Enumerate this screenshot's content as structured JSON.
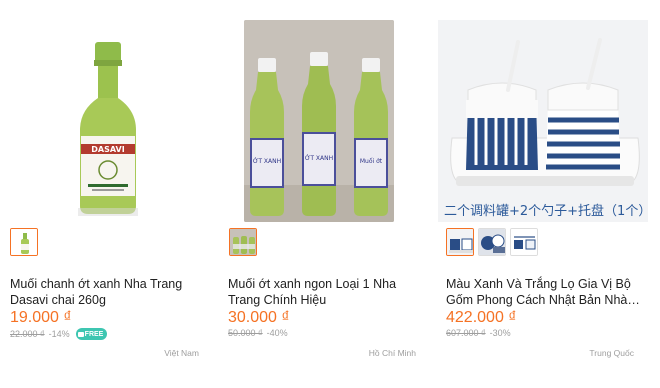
{
  "products": [
    {
      "title": "Muối chanh ớt xanh Nha Trang Dasavi chai 260g",
      "price": "19.000 ₫",
      "original_price": "22.000 ₫",
      "discount": "-14%",
      "badge": "FREE",
      "location": "Việt Nam",
      "image_text": {
        "brand": "DASAVI"
      }
    },
    {
      "title": "Muối ớt xanh ngon Loại 1 Nha Trang Chính Hiệu",
      "price": "30.000 ₫",
      "original_price": "50.000 ₫",
      "discount": "-40%",
      "location": "Hồ Chí Minh",
      "image_text": {
        "label_1": "ỚT XANH",
        "label_2": "ỚT XANH",
        "label_3": "Muối ớt"
      }
    },
    {
      "title": "Màu Xanh Và Trắng Lọ Gia Vị Bộ Gốm Phong Cách Nhật Bản Nhà Bếp Hộp...",
      "price": "422.000 ₫",
      "original_price": "607.000 ₫",
      "discount": "-30%",
      "location": "Trung Quốc",
      "image_text": {
        "caption": "二个调料罐+2个勺子+托盘（1个）"
      }
    }
  ],
  "colors": {
    "price": "#f57224",
    "muted": "#9e9e9e",
    "free_badge": "#3ec6b1"
  }
}
